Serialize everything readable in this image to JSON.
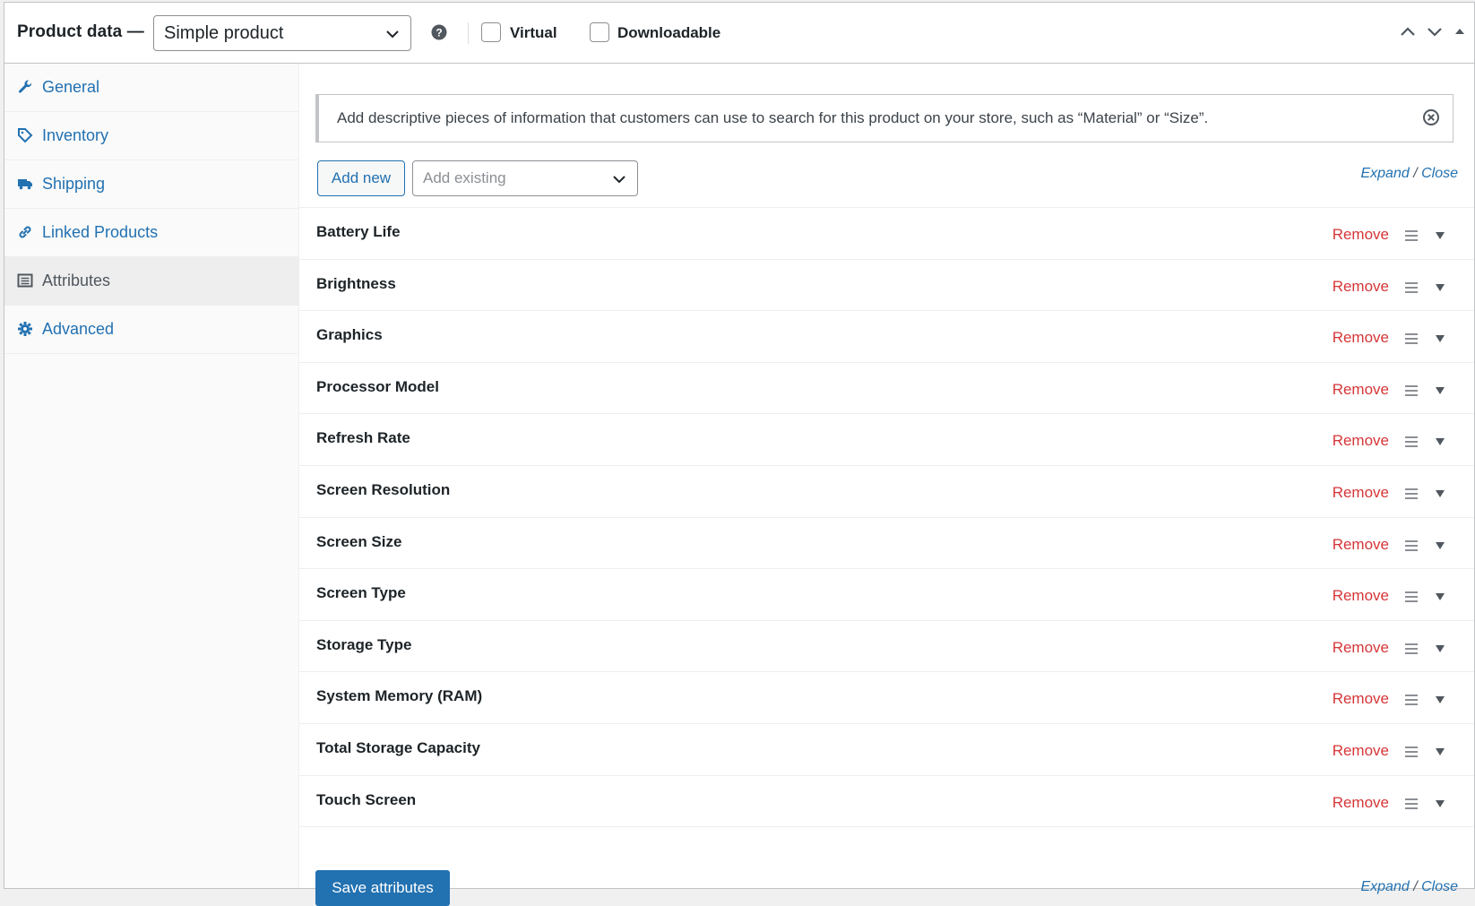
{
  "header": {
    "title": "Product data —",
    "product_type": "Simple product",
    "virtual_label": "Virtual",
    "downloadable_label": "Downloadable"
  },
  "sidebar": {
    "items": [
      {
        "label": "General",
        "icon": "wrench-icon"
      },
      {
        "label": "Inventory",
        "icon": "tag-icon"
      },
      {
        "label": "Shipping",
        "icon": "truck-icon"
      },
      {
        "label": "Linked Products",
        "icon": "link-icon"
      },
      {
        "label": "Attributes",
        "icon": "list-icon",
        "active": true
      },
      {
        "label": "Advanced",
        "icon": "gear-icon"
      }
    ]
  },
  "main": {
    "notice": "Add descriptive pieces of information that customers can use to search for this product on your store, such as “Material” or “Size”.",
    "add_new_label": "Add new",
    "add_existing_placeholder": "Add existing",
    "expand_label": "Expand",
    "close_label": "Close",
    "remove_label": "Remove",
    "attributes": [
      "Battery Life",
      "Brightness",
      "Graphics",
      "Processor Model",
      "Refresh Rate",
      "Screen Resolution",
      "Screen Size",
      "Screen Type",
      "Storage Type",
      "System Memory (RAM)",
      "Total Storage Capacity",
      "Touch Screen"
    ],
    "save_label": "Save attributes"
  },
  "colors": {
    "link": "#2271b1",
    "remove": "#d63638",
    "primary_button": "#2271b1"
  }
}
